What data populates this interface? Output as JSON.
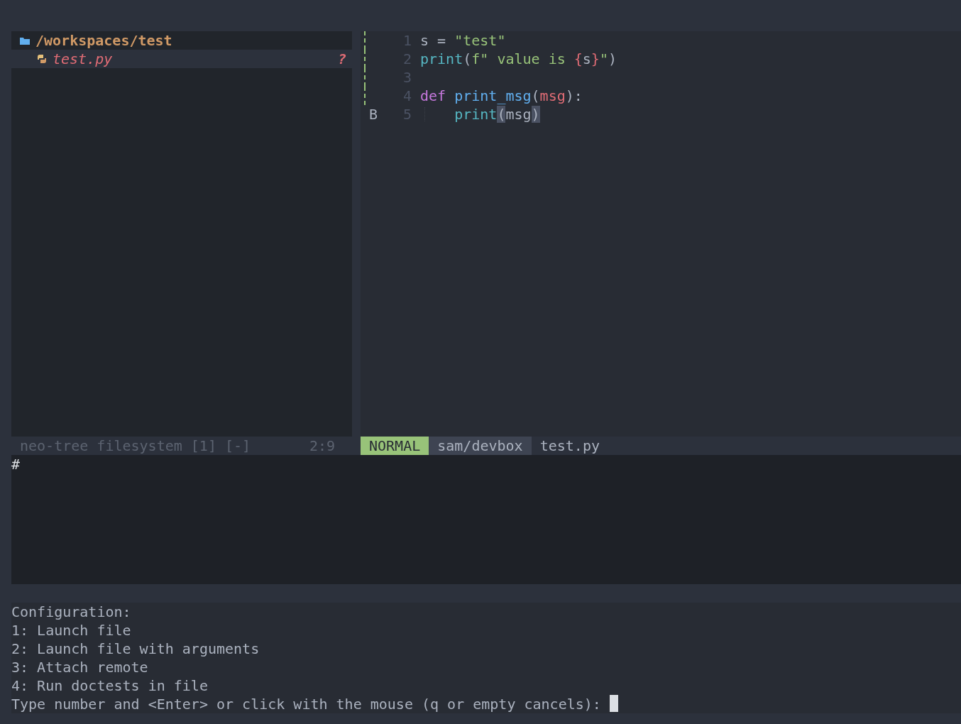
{
  "tree": {
    "root": "/workspaces/test",
    "items": [
      {
        "name": "test.py",
        "status": "?",
        "selected": true
      }
    ]
  },
  "editor": {
    "lines": [
      {
        "number": "1",
        "added": true,
        "tokens": [
          {
            "kind": "var",
            "text": "s"
          },
          {
            "kind": "op",
            "text": " = "
          },
          {
            "kind": "string",
            "text": "\"test\""
          }
        ]
      },
      {
        "number": "2",
        "added": true,
        "tokens": [
          {
            "kind": "builtin",
            "text": "print"
          },
          {
            "kind": "op",
            "text": "("
          },
          {
            "kind": "string",
            "text": "f\" value is "
          },
          {
            "kind": "brace",
            "text": "{"
          },
          {
            "kind": "var",
            "text": "s"
          },
          {
            "kind": "brace",
            "text": "}"
          },
          {
            "kind": "string",
            "text": "\""
          },
          {
            "kind": "op",
            "text": ")"
          }
        ]
      },
      {
        "number": "3",
        "added": true
      },
      {
        "number": "4",
        "added": true,
        "tokens": [
          {
            "kind": "keyword",
            "text": "def "
          },
          {
            "kind": "function",
            "text": "print_msg"
          },
          {
            "kind": "op",
            "text": "("
          },
          {
            "kind": "param",
            "text": "msg"
          },
          {
            "kind": "op",
            "text": "):"
          }
        ]
      },
      {
        "number": "5",
        "added": false,
        "sign": "B",
        "indent_guide": true,
        "tokens": [
          {
            "kind": "builtin",
            "text": "    print"
          },
          {
            "kind": "match",
            "text": "("
          },
          {
            "kind": "var",
            "text": "msg"
          },
          {
            "kind": "match",
            "text": ")"
          }
        ]
      }
    ]
  },
  "status_left": {
    "name": "neo-tree filesystem [1] [-]",
    "position": "2:9"
  },
  "status_right": {
    "mode": "NORMAL",
    "branch": "sam/devbox",
    "file": "test.py"
  },
  "terminal": {
    "prompt": "#"
  },
  "messages": [
    "Configuration:",
    "1: Launch file",
    "2: Launch file with arguments",
    "3: Attach remote",
    "4: Run doctests in file"
  ],
  "prompt": "Type number and <Enter> or click with the mouse (q or empty cancels): "
}
